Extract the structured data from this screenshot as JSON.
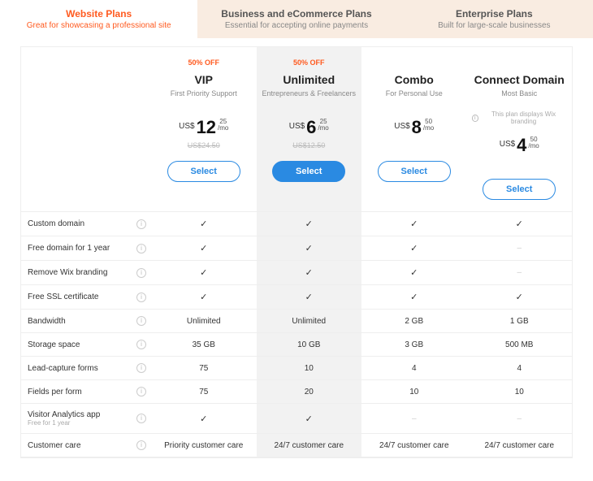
{
  "tabs": [
    {
      "title": "Website Plans",
      "sub": "Great for showcasing a professional site",
      "active": true
    },
    {
      "title": "Business and eCommerce Plans",
      "sub": "Essential for accepting online payments",
      "active": false
    },
    {
      "title": "Enterprise Plans",
      "sub": "Built for large-scale businesses",
      "active": false
    }
  ],
  "currency": "US$",
  "per": "/mo",
  "select_label": "Select",
  "plans": [
    {
      "id": "vip",
      "badge": "50% OFF",
      "name": "VIP",
      "sub": "First Priority Support",
      "note": "",
      "big": "12",
      "cents": "25",
      "strike": "US$24.50",
      "highlight": false,
      "primary": false
    },
    {
      "id": "unlimited",
      "badge": "50% OFF",
      "name": "Unlimited",
      "sub": "Entrepreneurs & Freelancers",
      "note": "",
      "big": "6",
      "cents": "25",
      "strike": "US$12.50",
      "highlight": true,
      "primary": true
    },
    {
      "id": "combo",
      "badge": "",
      "name": "Combo",
      "sub": "For Personal Use",
      "note": "",
      "big": "8",
      "cents": "50",
      "strike": "",
      "highlight": false,
      "primary": false
    },
    {
      "id": "connect",
      "badge": "",
      "name": "Connect Domain",
      "sub": "Most Basic",
      "note": "This plan displays Wix branding",
      "big": "4",
      "cents": "50",
      "strike": "",
      "highlight": false,
      "primary": false
    }
  ],
  "rows": [
    {
      "label": "Custom domain",
      "sub": "",
      "values": [
        "✓",
        "✓",
        "✓",
        "✓"
      ]
    },
    {
      "label": "Free domain for 1 year",
      "sub": "",
      "values": [
        "✓",
        "✓",
        "✓",
        "–"
      ]
    },
    {
      "label": "Remove Wix branding",
      "sub": "",
      "values": [
        "✓",
        "✓",
        "✓",
        "–"
      ]
    },
    {
      "label": "Free SSL certificate",
      "sub": "",
      "values": [
        "✓",
        "✓",
        "✓",
        "✓"
      ]
    },
    {
      "label": "Bandwidth",
      "sub": "",
      "values": [
        "Unlimited",
        "Unlimited",
        "2 GB",
        "1 GB"
      ]
    },
    {
      "label": "Storage space",
      "sub": "",
      "values": [
        "35 GB",
        "10 GB",
        "3 GB",
        "500 MB"
      ]
    },
    {
      "label": "Lead-capture forms",
      "sub": "",
      "values": [
        "75",
        "10",
        "4",
        "4"
      ]
    },
    {
      "label": "Fields per form",
      "sub": "",
      "values": [
        "75",
        "20",
        "10",
        "10"
      ]
    },
    {
      "label": "Visitor Analytics app",
      "sub": "Free for 1 year",
      "values": [
        "✓",
        "✓",
        "–",
        "–"
      ]
    },
    {
      "label": "Customer care",
      "sub": "",
      "values": [
        "Priority customer care",
        "24/7 customer care",
        "24/7 customer care",
        "24/7 customer care"
      ]
    }
  ]
}
